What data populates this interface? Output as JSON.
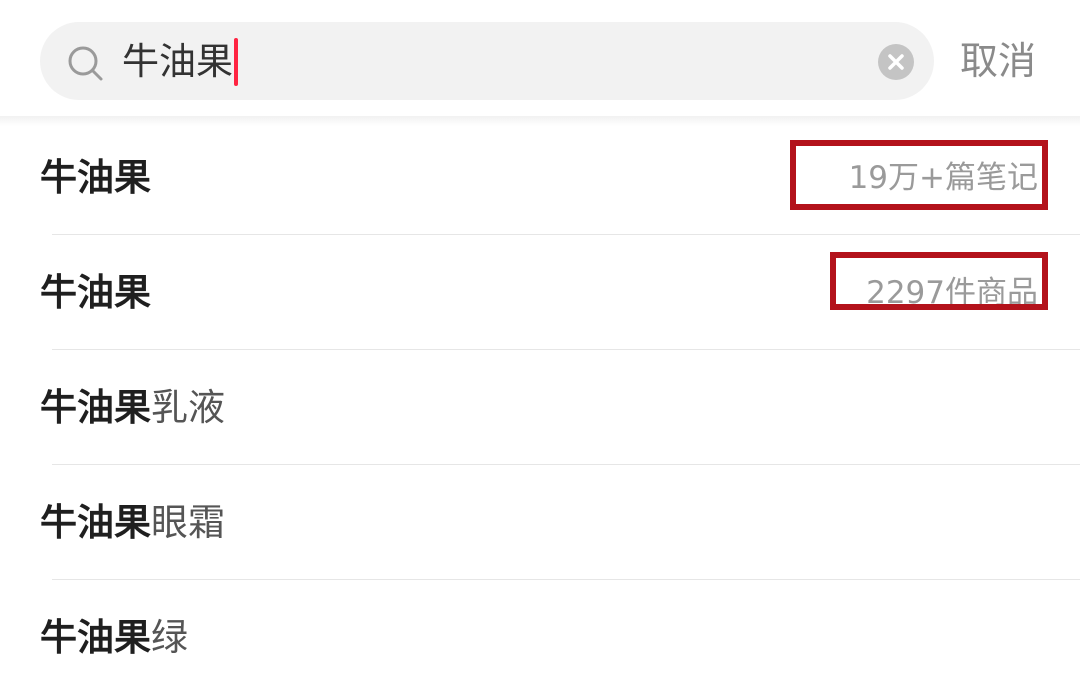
{
  "search": {
    "query": "牛油果",
    "cancel_label": "取消"
  },
  "icons": {
    "search": "search-icon",
    "clear": "clear-icon"
  },
  "colors": {
    "caret": "#ff2442",
    "annotation": "#b3121b"
  },
  "suggestions": [
    {
      "keyword": "牛油果",
      "suffix": "",
      "meta": "19万+篇笔记",
      "highlighted": true
    },
    {
      "keyword": "牛油果",
      "suffix": "",
      "meta": "2297件商品",
      "highlighted": true
    },
    {
      "keyword": "牛油果",
      "suffix": "乳液",
      "meta": "",
      "highlighted": false
    },
    {
      "keyword": "牛油果",
      "suffix": "眼霜",
      "meta": "",
      "highlighted": false
    },
    {
      "keyword": "牛油果",
      "suffix": "绿",
      "meta": "",
      "highlighted": false
    }
  ]
}
